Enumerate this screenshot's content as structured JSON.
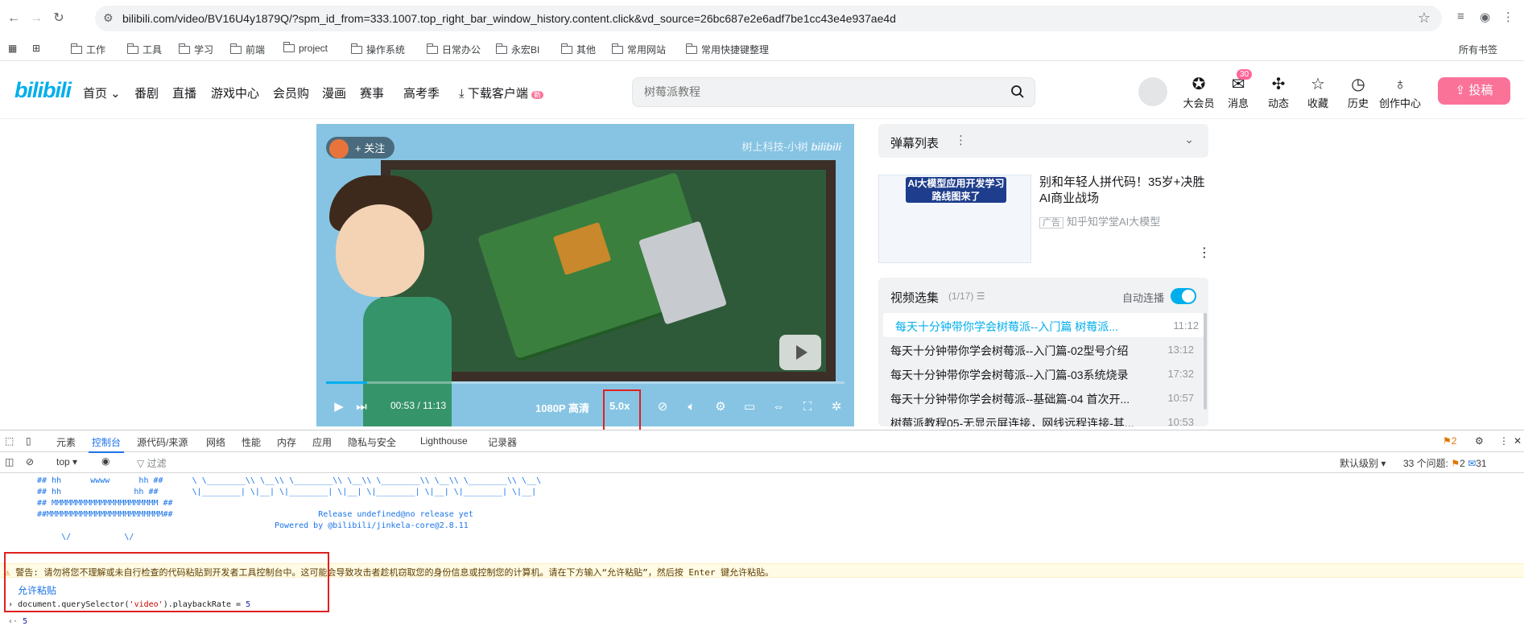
{
  "browser": {
    "url": "bilibili.com/video/BV16U4y1879Q/?spm_id_from=333.1007.top_right_bar_window_history.content.click&vd_source=26bc687e2e6adf7be1cc43e4e937ae4d",
    "bookmarks": [
      "工作",
      "工具",
      "学习",
      "前端",
      "project",
      "操作系统",
      "日常办公",
      "永宏BI",
      "其他",
      "常用网站",
      "常用快捷键整理"
    ],
    "bookmarks_right": "所有书签"
  },
  "header": {
    "logo": "bilibili",
    "nav": [
      "首页",
      "番剧",
      "直播",
      "游戏中心",
      "会员购",
      "漫画",
      "赛事",
      "高考季",
      "下载客户端"
    ],
    "nav_new_badge": "新",
    "search_placeholder": "树莓派教程",
    "right": [
      "大会员",
      "消息",
      "动态",
      "收藏",
      "历史",
      "创作中心"
    ],
    "message_count": "30",
    "upload": "投稿"
  },
  "video": {
    "follow": "+ 关注",
    "watermark": "树上科技-小树",
    "watermark_logo": "bilibili",
    "current_time": "00:53",
    "separator": "/",
    "duration": "11:13",
    "quality": "1080P 高清",
    "speed": "5.0x",
    "progress_fraction": 0.079
  },
  "sidebar": {
    "danmaku_title": "弹幕列表",
    "ad_thumb_text": "AI大模型应用开发学习路线图来了",
    "ad_title": "别和年轻人拼代码！35岁+决胜AI商业战场",
    "ad_badge": "广告",
    "ad_source": "知乎知学堂AI大模型",
    "playlist_title": "视频选集",
    "playlist_count": "(1/17)",
    "autoplay_label": "自动连播",
    "items": [
      {
        "title": "每天十分钟带你学会树莓派--入门篇 树莓派...",
        "duration": "11:12"
      },
      {
        "title": "每天十分钟带你学会树莓派--入门篇-02型号介绍",
        "duration": "13:12"
      },
      {
        "title": "每天十分钟带你学会树莓派--入门篇-03系统烧录",
        "duration": "17:32"
      },
      {
        "title": "每天十分钟带你学会树莓派--基础篇-04 首次开...",
        "duration": "10:57"
      },
      {
        "title": "树莓派教程05-无显示屏连接，网线远程连接-其...",
        "duration": "10:53"
      }
    ]
  },
  "devtools": {
    "tabs": [
      "元素",
      "控制台",
      "源代码/来源",
      "网络",
      "性能",
      "内存",
      "应用",
      "隐私与安全",
      "Lighthouse",
      "记录器"
    ],
    "active_tab": "控制台",
    "issues_badge": "2",
    "context": "top",
    "filter_placeholder": "过滤",
    "level": "默认级别",
    "issues_label": "33 个问题:",
    "issues_warn": "2",
    "issues_info": "31",
    "ascii_lines": [
      "## hh      wwww      hh ##      \\ \\________\\\\ \\__\\\\ \\________\\\\ \\__\\\\ \\________\\\\ \\__\\\\ \\________\\\\ \\__\\",
      "## hh               hh ##       \\|________| \\|__| \\|________| \\|__| \\|________| \\|__| \\|________| \\|__|",
      "## MMMMMMMMMMMMMMMMMMMMMM ##",
      "##MMMMMMMMMMMMMMMMMMMMMMMM##                              Release undefined@no release yet",
      "                                                 Powered by @bilibili/jinkela-core@2.8.11",
      "     \\/           \\/"
    ],
    "warning": "警告: 请勿将您不理解或未自行检查的代码粘贴到开发者工具控制台中。这可能会导致攻击者趁机窃取您的身份信息或控制您的计算机。请在下方输入“允许粘贴”，然后按 Enter 键允许粘贴。",
    "allow_paste": "允许粘贴",
    "command_prefix": "document.querySelector(",
    "command_string": "'video'",
    "command_suffix": ").playbackRate = ",
    "command_value": "5",
    "result": "5"
  }
}
